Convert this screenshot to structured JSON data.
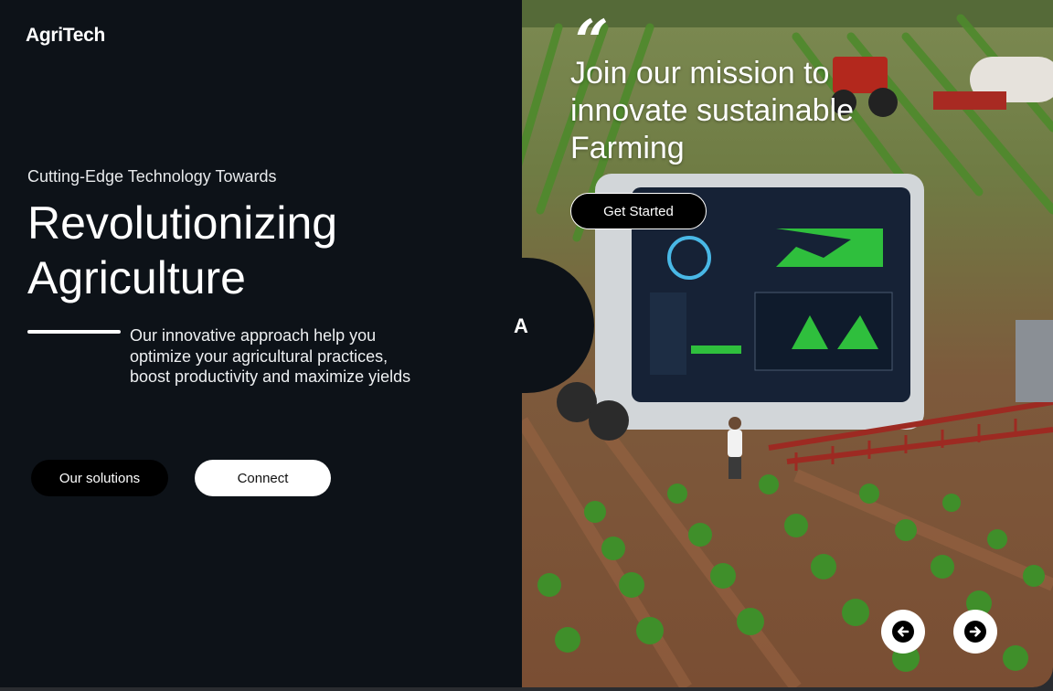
{
  "brand": {
    "name": "AgriTech"
  },
  "intro": {
    "eyebrow": "Cutting-Edge Technology Towards",
    "headline_line1": "Revolutionizing",
    "headline_line2": "Agriculture",
    "description": "Our innovative approach help you optimize your agricultural practices, boost productivity and maximize yields"
  },
  "actions": {
    "primary_label": "Our solutions",
    "secondary_label": "Connect"
  },
  "hero": {
    "quote_glyph": "“",
    "title": "Join our mission to innovate sustainable Farming",
    "cta_label": "Get Started",
    "side_letter": "A",
    "prev_icon": "arrow-left-circle-icon",
    "next_icon": "arrow-right-circle-icon"
  },
  "colors": {
    "background": "#0d1218",
    "text": "#ffffff",
    "button_dark": "#000000",
    "button_light": "#ffffff"
  }
}
